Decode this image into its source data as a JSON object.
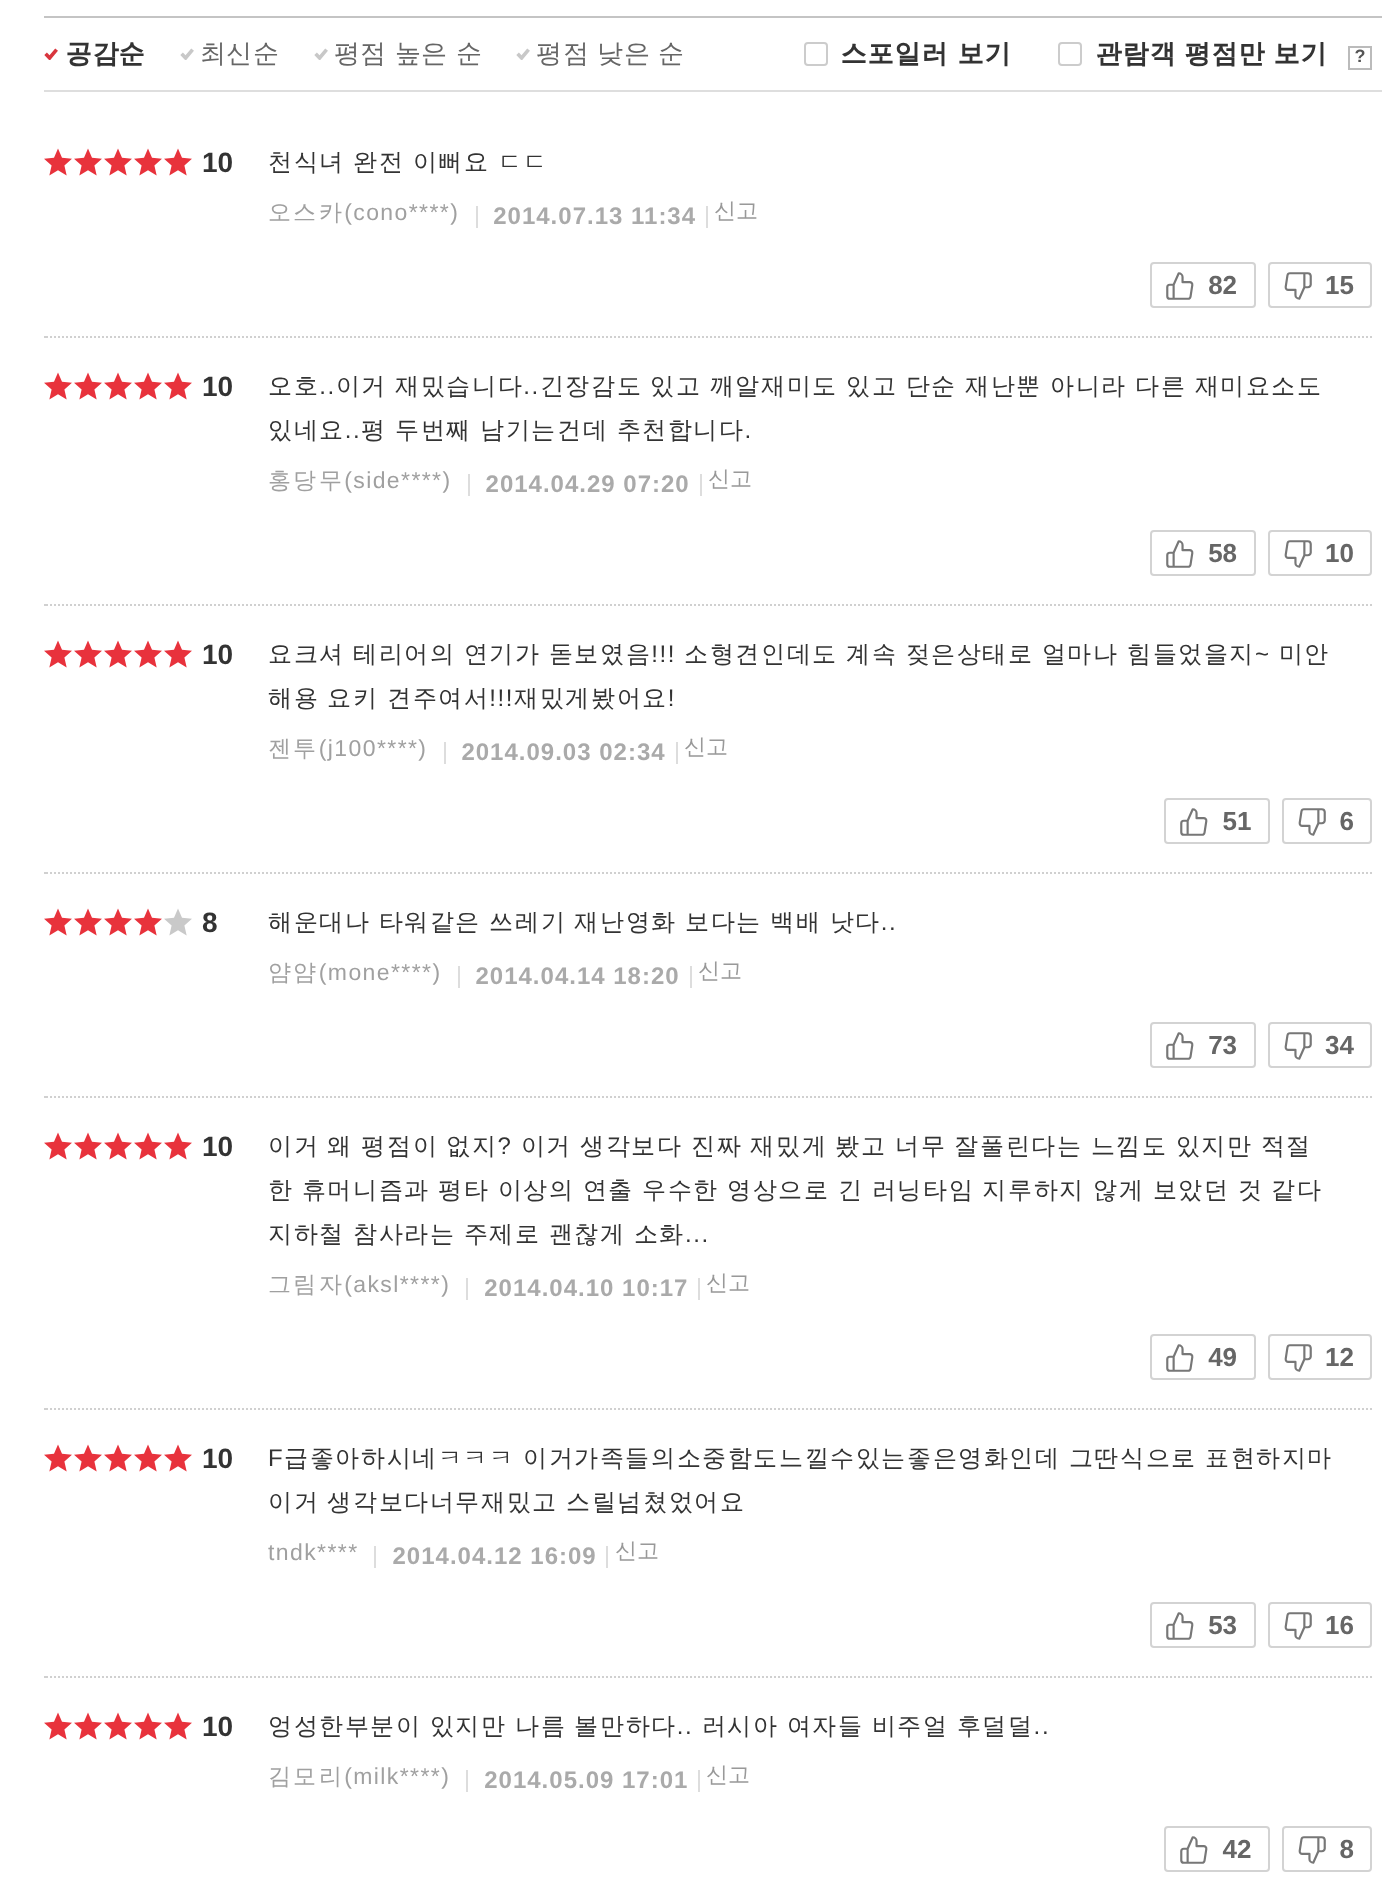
{
  "sort_tabs": [
    {
      "label": "공감순",
      "selected": true
    },
    {
      "label": "최신순",
      "selected": false
    },
    {
      "label": "평점 높은 순",
      "selected": false
    },
    {
      "label": "평점 낮은 순",
      "selected": false
    }
  ],
  "filters": [
    {
      "label": "스포일러 보기",
      "checked": false
    },
    {
      "label": "관람객 평점만 보기",
      "checked": false
    }
  ],
  "help": {
    "label": "?"
  },
  "reviews": [
    {
      "stars": 5,
      "score": "10",
      "text": "천식녀 완전 이뻐요 ㄷㄷ",
      "author": "오스카(cono****)",
      "date": "2014.07.13 11:34",
      "report": "신고",
      "likes": "82",
      "dislikes": "15"
    },
    {
      "stars": 5,
      "score": "10",
      "text": "오호..이거 재밌습니다..긴장감도 있고 깨알재미도 있고 단순 재난뿐 아니라 다른 재미요소도 있네요..평 두번째 남기는건데 추천합니다.",
      "author": "홍당무(side****)",
      "date": "2014.04.29 07:20",
      "report": "신고",
      "likes": "58",
      "dislikes": "10"
    },
    {
      "stars": 5,
      "score": "10",
      "text": "요크셔 테리어의 연기가 돋보였음!!! 소형견인데도 계속 젖은상태로 얼마나 힘들었을지~ 미안해용 요키 견주여서!!!재밌게봤어요!",
      "author": "젠투(j100****)",
      "date": "2014.09.03 02:34",
      "report": "신고",
      "likes": "51",
      "dislikes": "6"
    },
    {
      "stars": 4,
      "score": "8",
      "text": "해운대나 타워같은 쓰레기 재난영화 보다는 백배 낫다..",
      "author": "얌얌(mone****)",
      "date": "2014.04.14 18:20",
      "report": "신고",
      "likes": "73",
      "dislikes": "34"
    },
    {
      "stars": 5,
      "score": "10",
      "text": "이거 왜 평점이 없지? 이거 생각보다 진짜 재밌게 봤고 너무 잘풀린다는 느낌도 있지만 적절한 휴머니즘과 평타 이상의 연출 우수한 영상으로 긴 러닝타임 지루하지 않게 보았던 것 같다 지하철 참사라는 주제로 괜찮게 소화...",
      "author": "그림자(aksl****)",
      "date": "2014.04.10 10:17",
      "report": "신고",
      "likes": "49",
      "dislikes": "12"
    },
    {
      "stars": 5,
      "score": "10",
      "text": "F급좋아하시네ㅋㅋㅋ 이거가족들의소중함도느낄수있는좋은영화인데 그딴식으로 표현하지마 이거 생각보다너무재밌고 스릴넘쳤었어요",
      "author": "tndk****",
      "date": "2014.04.12 16:09",
      "report": "신고",
      "likes": "53",
      "dislikes": "16"
    },
    {
      "stars": 5,
      "score": "10",
      "text": "엉성한부분이 있지만 나름 볼만하다.. 러시아 여자들 비주얼 후덜덜..",
      "author": "김모리(milk****)",
      "date": "2014.05.09 17:01",
      "report": "신고",
      "likes": "42",
      "dislikes": "8"
    }
  ]
}
